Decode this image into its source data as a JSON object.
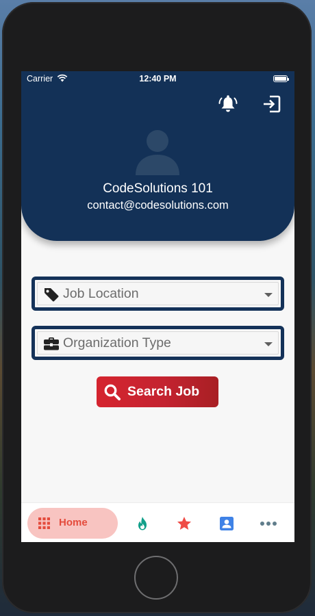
{
  "status_bar": {
    "carrier": "Carrier",
    "time": "12:40 PM"
  },
  "header": {
    "notification_icon": "bell-alarm-icon",
    "logout_icon": "exit-door-icon",
    "avatar_icon": "person-silhouette-icon",
    "user_name": "CodeSolutions 101",
    "user_email": "contact@codesolutions.com"
  },
  "filters": {
    "job_location": {
      "icon": "tag-icon",
      "placeholder": "Job Location"
    },
    "organization_type": {
      "icon": "briefcase-icon",
      "placeholder": "Organization Type"
    }
  },
  "search_button": {
    "icon": "search-icon",
    "label": "Search Job"
  },
  "bottom_nav": {
    "items": [
      {
        "icon": "grid-icon",
        "label": "Home",
        "active": true
      },
      {
        "icon": "flame-icon",
        "label": ""
      },
      {
        "icon": "star-icon",
        "label": ""
      },
      {
        "icon": "contact-card-icon",
        "label": ""
      },
      {
        "icon": "more-dots-icon",
        "label": ""
      }
    ]
  },
  "colors": {
    "header_bg": "#133157",
    "accent_red": "#d5242f",
    "nav_active_bg": "#f8c4c1",
    "nav_active_text": "#e44b3c",
    "flame": "#12a08a",
    "star": "#ef4b45",
    "contact": "#3f82e6",
    "more": "#607d8b"
  }
}
